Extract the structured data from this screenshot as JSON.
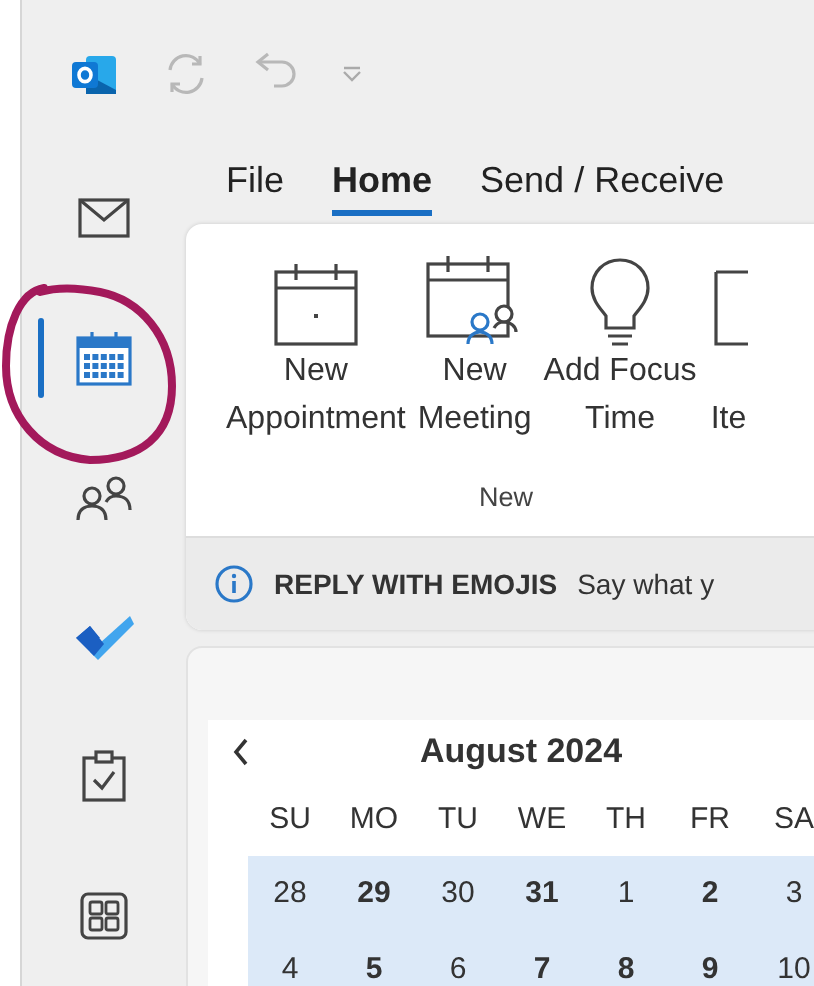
{
  "nav": [
    {
      "kind": "mail",
      "selected": false
    },
    {
      "kind": "calendar",
      "selected": true
    },
    {
      "kind": "people",
      "selected": false
    },
    {
      "kind": "todo",
      "selected": false
    },
    {
      "kind": "tasks",
      "selected": false
    },
    {
      "kind": "apps",
      "selected": false
    }
  ],
  "tabs": [
    {
      "label": "File",
      "selected": false
    },
    {
      "label": "Home",
      "selected": true
    },
    {
      "label": "Send / Receive",
      "selected": false
    }
  ],
  "ribbon": {
    "group": "New",
    "buttons": [
      {
        "kind": "appointment",
        "line1": "New",
        "line2": "Appointment"
      },
      {
        "kind": "meeting",
        "line1": "New",
        "line2": "Meeting"
      },
      {
        "kind": "focus",
        "line1": "Add Focus",
        "line2": "Time"
      },
      {
        "kind": "item",
        "line2": "Ite"
      }
    ]
  },
  "info_bar": {
    "title": "REPLY WITH EMOJIS",
    "message": "Say what y"
  },
  "calendar": {
    "month": "August 2024",
    "weekdays": [
      "SU",
      "MO",
      "TU",
      "WE",
      "TH",
      "FR",
      "SA"
    ],
    "weeks": [
      [
        {
          "day": "28",
          "bold": false
        },
        {
          "day": "29",
          "bold": true
        },
        {
          "day": "30",
          "bold": false
        },
        {
          "day": "31",
          "bold": true
        },
        {
          "day": "1",
          "bold": false
        },
        {
          "day": "2",
          "bold": true
        },
        {
          "day": "3",
          "bold": false
        }
      ],
      [
        {
          "day": "4",
          "bold": false
        },
        {
          "day": "5",
          "bold": true
        },
        {
          "day": "6",
          "bold": false
        },
        {
          "day": "7",
          "bold": true
        },
        {
          "day": "8",
          "bold": true
        },
        {
          "day": "9",
          "bold": true
        },
        {
          "day": "10",
          "bold": false
        }
      ]
    ]
  },
  "annotation": {
    "kind": "circle",
    "color": "#a3195b"
  }
}
